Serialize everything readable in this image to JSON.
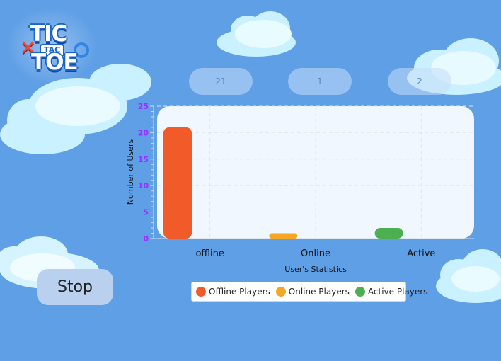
{
  "logo": {
    "line1": "TIC",
    "middle": "TAC",
    "line2": "TOE"
  },
  "stats": {
    "offline_count": "21",
    "online_count": "1",
    "active_count": "2"
  },
  "stop_button": "Stop",
  "colors": {
    "background": "#5f9fe6",
    "offline": "#f15a29",
    "online": "#f5a623",
    "active": "#4caf50",
    "axis_text": "#9b30ff"
  },
  "chart_data": {
    "type": "bar",
    "categories": [
      "offline",
      "Online",
      "Active"
    ],
    "values": [
      21,
      1,
      2
    ],
    "xlabel": "User's Statistics",
    "ylabel": "Number of Users",
    "ylim": [
      0,
      25
    ],
    "yticks": [
      0,
      5,
      10,
      15,
      20,
      25
    ],
    "grid": true,
    "legend_position": "bottom",
    "series": [
      {
        "name": "Offline Players",
        "color": "#f15a29"
      },
      {
        "name": "Online Players",
        "color": "#f5a623"
      },
      {
        "name": "Active Players",
        "color": "#4caf50"
      }
    ]
  }
}
